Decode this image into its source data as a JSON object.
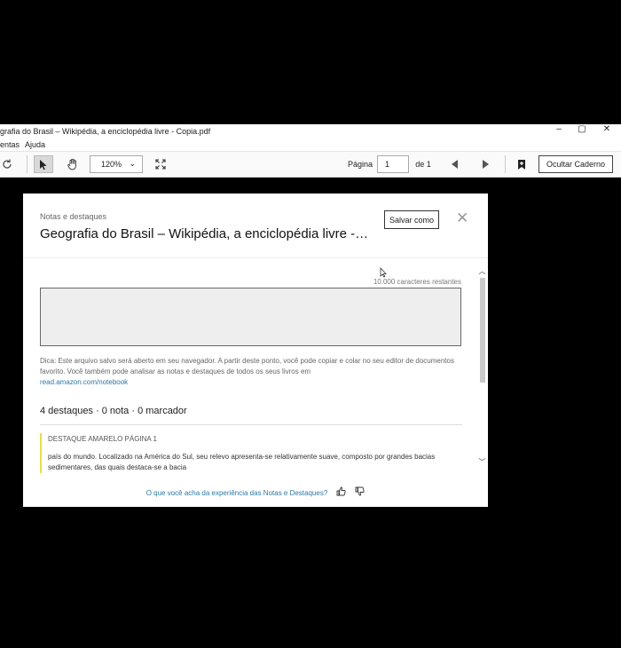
{
  "window": {
    "title": "grafia do Brasil – Wikipédia, a enciclopédia livre - Copia.pdf",
    "controls": [
      "–",
      "▢",
      "✕"
    ]
  },
  "menu": {
    "items": [
      "entas",
      "Ajuda"
    ]
  },
  "toolbar": {
    "zoom": "120%",
    "page_label": "Página",
    "page_value": "1",
    "page_of": "de 1",
    "hide_notebook": "Ocultar Caderno"
  },
  "notes_panel": {
    "section_label": "Notas e destaques",
    "title": "Geografia do Brasil – Wikipédia, a enciclopédia livre -…",
    "save_as": "Salvar como",
    "chars_remaining": "10.000 caracteres restantes",
    "tip_text": "Dica: Este arquivo salvo será aberto em seu navegador. A partir deste ponto, você pode copiar e colar no seu editor de documentos favorito. Você também pode analisar as notas e destaques de todos os seus livros em",
    "tip_link": "read.amazon.com/notebook",
    "counts": "4 destaques · 0 nota · 0 marcador",
    "highlight": {
      "label": "DESTAQUE AMARELO   PÁGINA 1",
      "text": "país do mundo. Localizado na América do Sul, seu relevo apresenta-se relativamente suave, composto por grandes bacias sedimentares, das quais destaca-se a bacia",
      "color": "#e4df4f"
    },
    "feedback_question": "O que você acha da experiência das Notas e Destaques?"
  }
}
